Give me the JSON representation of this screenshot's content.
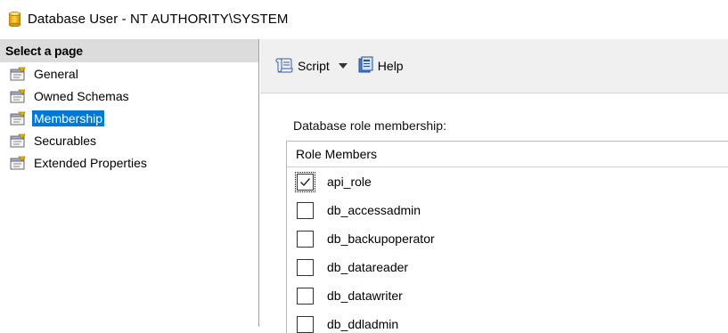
{
  "window": {
    "title": "Database User - NT AUTHORITY\\SYSTEM",
    "icon": "database-icon"
  },
  "sidebar": {
    "header": "Select a page",
    "items": [
      {
        "label": "General",
        "icon": "page-icon",
        "selected": false
      },
      {
        "label": "Owned Schemas",
        "icon": "page-icon",
        "selected": false
      },
      {
        "label": "Membership",
        "icon": "page-icon",
        "selected": true
      },
      {
        "label": "Securables",
        "icon": "page-icon",
        "selected": false
      },
      {
        "label": "Extended Properties",
        "icon": "page-icon",
        "selected": false
      }
    ]
  },
  "toolbar": {
    "script_label": "Script",
    "help_label": "Help"
  },
  "membership": {
    "section_label": "Database role membership:",
    "column_header": "Role Members",
    "roles": [
      {
        "name": "api_role",
        "checked": true
      },
      {
        "name": "db_accessadmin",
        "checked": false
      },
      {
        "name": "db_backupoperator",
        "checked": false
      },
      {
        "name": "db_datareader",
        "checked": false
      },
      {
        "name": "db_datawriter",
        "checked": false
      },
      {
        "name": "db_ddladmin",
        "checked": false
      }
    ]
  },
  "colors": {
    "selection": "#0078d7",
    "header_bg": "#dcdcdc",
    "toolbar_bg": "#f0f0f0"
  }
}
